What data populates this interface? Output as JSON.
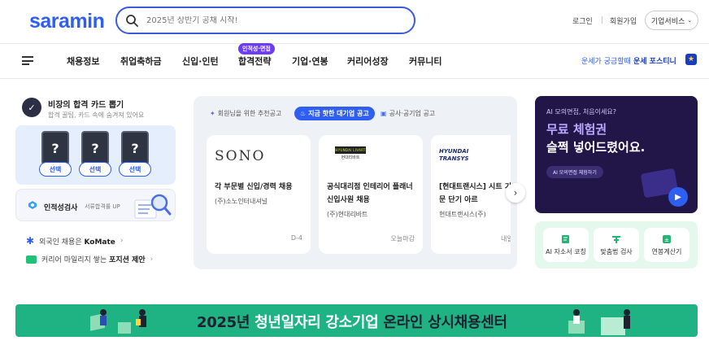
{
  "header": {
    "logo": "saramin",
    "search_placeholder": "2025년 상반기 공채 시작!",
    "login": "로그인",
    "signup": "회원가입",
    "corp_service": "기업서비스"
  },
  "nav": {
    "items": [
      "채용정보",
      "취업축하금",
      "신입·인턴",
      "합격전략",
      "기업·연봉",
      "커리어성장",
      "커뮤니티"
    ],
    "badge": "인적성·면접",
    "fortune_light": "운세가 궁금할때",
    "fortune_strong": "운세 포스티니"
  },
  "card_game": {
    "title": "비장의 합격 카드 뽑기",
    "subtitle": "합격 꿀팁, 카드 속에 숨겨져 있어요",
    "card_symbol": "?",
    "pick_label": "선택"
  },
  "aptitude": {
    "label": "인적성검사",
    "sub": "서류합격률 UP"
  },
  "links": [
    {
      "prefix": "외국인 채용은 ",
      "strong": "KoMate",
      "suffix": ""
    },
    {
      "prefix": "커리어 마일리지 쌓는 ",
      "strong": "포지션 제안",
      "suffix": ""
    }
  ],
  "jobs": {
    "tabs": [
      {
        "label": "회원님을 위한 추천공고",
        "active": false
      },
      {
        "label": "지금 핫한 대기업 공고",
        "active": true
      },
      {
        "label": "공사·공기업 공고",
        "active": false
      }
    ],
    "cards": [
      {
        "logo": "SONO",
        "title": "각 부문별 신입/경력 채용",
        "company": "(주)소노인터내셔널",
        "due": "D-4"
      },
      {
        "logo": "HYUNDAI LIVART",
        "logo_sub": "현대리바트",
        "title": "공식대리점 인테리어 플래너 신입사원 채용",
        "company": "(주)현대리바트",
        "due": "오늘마감"
      },
      {
        "logo": "HYUNDAI TRANSYS",
        "title": "[현대트랜시스] 시트 기술 부문 단기 아르",
        "company": "현대트랜시스(주)",
        "due": "내일"
      }
    ]
  },
  "ad": {
    "small": "AI 모의면접, 처음이세요?",
    "line1": "무료 체험권",
    "line2": "슬쩍 넣어드렸어요.",
    "pill": "AI 모의면접 체험하기"
  },
  "tools": [
    "AI 자소서 코칭",
    "맞춤법 검사",
    "연봉계산기"
  ],
  "banner": {
    "pre": "2025년 ",
    "highlight": "청년일자리 강소기업",
    "post": " 온라인 상시채용센터"
  },
  "colors": {
    "brand": "#2f5ff0",
    "badge": "#6c3df2",
    "banner": "#1fb383",
    "ad_bg": "#221649"
  }
}
